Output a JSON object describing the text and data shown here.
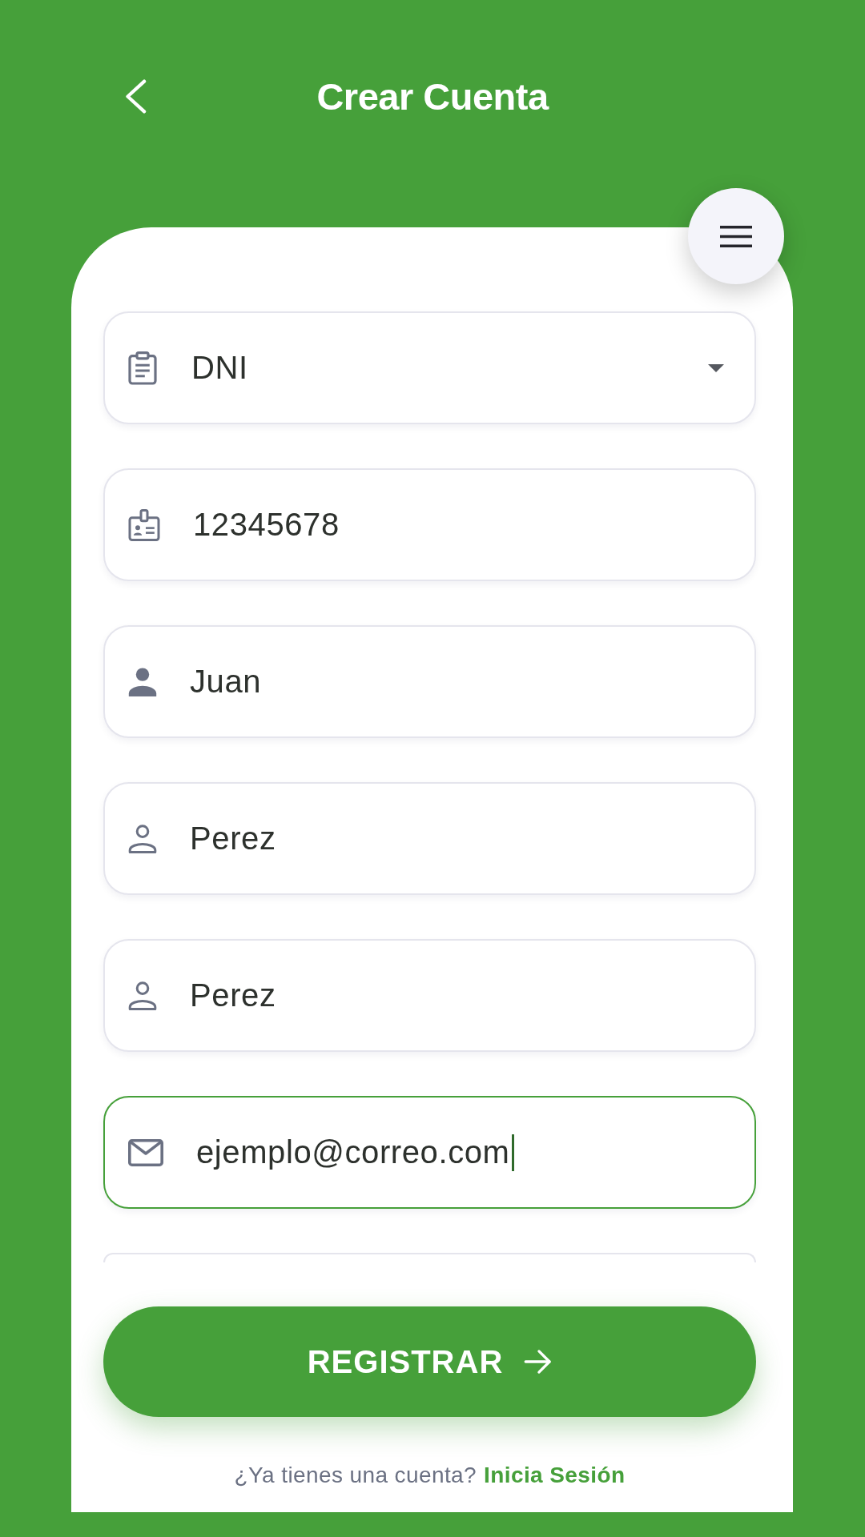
{
  "header": {
    "title": "Crear Cuenta"
  },
  "form": {
    "fields": [
      {
        "kind": "select",
        "value": "DNI",
        "focused": false
      },
      {
        "kind": "document",
        "value": "12345678",
        "focused": false
      },
      {
        "kind": "name",
        "value": "Juan",
        "focused": false
      },
      {
        "kind": "surname",
        "value": "Perez",
        "focused": false
      },
      {
        "kind": "surname",
        "value": "Perez",
        "focused": false
      },
      {
        "kind": "email",
        "value": "ejemplo@correo.com",
        "focused": true
      }
    ],
    "more_below": true
  },
  "submit_button": {
    "label": "REGISTRAR"
  },
  "footer": {
    "prompt": "¿Ya tienes una cuenta?",
    "link": "Inicia Sesión"
  }
}
